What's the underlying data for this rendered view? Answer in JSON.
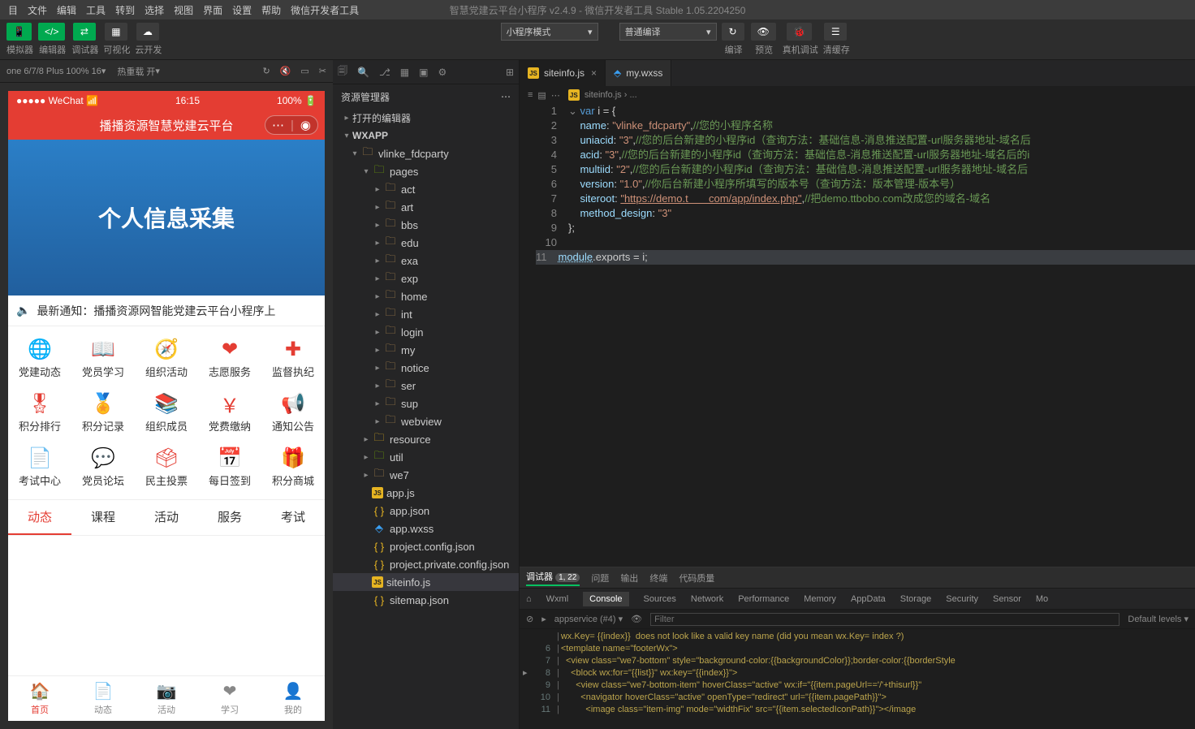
{
  "title": "智慧党建云平台小程序 v2.4.9 - 微信开发者工具 Stable 1.05.2204250",
  "menu": [
    "目",
    "文件",
    "编辑",
    "工具",
    "转到",
    "选择",
    "视图",
    "界面",
    "设置",
    "帮助",
    "微信开发者工具"
  ],
  "topButtons": [
    {
      "label": "模拟器"
    },
    {
      "label": "编辑器"
    },
    {
      "label": "调试器"
    },
    {
      "label": "可视化"
    },
    {
      "label": "云开发"
    }
  ],
  "toolbar": {
    "mode": "小程序模式",
    "compile": "普通编译",
    "compileBtn": "编译",
    "previewBtn": "预览",
    "remoteBtn": "真机调试",
    "cacheBtn": "清缓存"
  },
  "simulator": {
    "device": "one 6/7/8 Plus 100% 16",
    "hot": "热重载 开",
    "statusLeft": "●●●●● WeChat",
    "time": "16:15",
    "battery": "100%",
    "appTitle": "播播资源智慧党建云平台",
    "bannerTitle": "个人信息采集",
    "notice": "最新通知：播播资源网智能党建云平台小程序上",
    "grid": [
      "党建动态",
      "党员学习",
      "组织活动",
      "志愿服务",
      "监督执纪",
      "积分排行",
      "积分记录",
      "组织成员",
      "党费缴纳",
      "通知公告",
      "考试中心",
      "党员论坛",
      "民主投票",
      "每日签到",
      "积分商城"
    ],
    "gridIcons": [
      "🌐",
      "📖",
      "🧭",
      "❤",
      "✚",
      "🎖",
      "🏅",
      "📚",
      "￥",
      "📢",
      "📄",
      "💬",
      "🗳",
      "📅",
      "🎁"
    ],
    "tabs": [
      "动态",
      "课程",
      "活动",
      "服务",
      "考试"
    ],
    "bottom": [
      {
        "l": "首页"
      },
      {
        "l": "动态"
      },
      {
        "l": "活动"
      },
      {
        "l": "学习"
      },
      {
        "l": "我的"
      }
    ],
    "bottomIcons": [
      "🏠",
      "📄",
      "📷",
      "❤",
      "👤"
    ]
  },
  "explorer": {
    "header": "资源管理器",
    "openEditors": "打开的编辑器",
    "root": "WXAPP",
    "tree": [
      {
        "n": "vlinke_fdcparty",
        "t": "folder",
        "d": 1,
        "open": true
      },
      {
        "n": "pages",
        "t": "folder-g",
        "d": 2,
        "open": true
      },
      {
        "n": "act",
        "t": "folder",
        "d": 3
      },
      {
        "n": "art",
        "t": "folder",
        "d": 3
      },
      {
        "n": "bbs",
        "t": "folder",
        "d": 3
      },
      {
        "n": "edu",
        "t": "folder",
        "d": 3
      },
      {
        "n": "exa",
        "t": "folder",
        "d": 3
      },
      {
        "n": "exp",
        "t": "folder",
        "d": 3
      },
      {
        "n": "home",
        "t": "folder",
        "d": 3
      },
      {
        "n": "int",
        "t": "folder",
        "d": 3
      },
      {
        "n": "login",
        "t": "folder",
        "d": 3
      },
      {
        "n": "my",
        "t": "folder",
        "d": 3
      },
      {
        "n": "notice",
        "t": "folder",
        "d": 3
      },
      {
        "n": "ser",
        "t": "folder",
        "d": 3
      },
      {
        "n": "sup",
        "t": "folder",
        "d": 3
      },
      {
        "n": "webview",
        "t": "folder",
        "d": 3
      },
      {
        "n": "resource",
        "t": "folder-y",
        "d": 2
      },
      {
        "n": "util",
        "t": "folder-g",
        "d": 2
      },
      {
        "n": "we7",
        "t": "folder",
        "d": 2
      },
      {
        "n": "app.js",
        "t": "js",
        "d": 2
      },
      {
        "n": "app.json",
        "t": "json",
        "d": 2
      },
      {
        "n": "app.wxss",
        "t": "wxss",
        "d": 2
      },
      {
        "n": "project.config.json",
        "t": "json",
        "d": 2
      },
      {
        "n": "project.private.config.json",
        "t": "json",
        "d": 2
      },
      {
        "n": "siteinfo.js",
        "t": "js",
        "d": 2,
        "sel": true
      },
      {
        "n": "sitemap.json",
        "t": "json",
        "d": 2
      }
    ]
  },
  "editor": {
    "tabs": [
      {
        "n": "siteinfo.js",
        "t": "js",
        "active": true
      },
      {
        "n": "my.wxss",
        "t": "wxss"
      }
    ],
    "breadcrumb": "siteinfo.js › ...",
    "code": {
      "l1": {
        "kw": "var",
        "v": " i = {"
      },
      "l2": {
        "p": "name",
        "s": "\"vlinke_fdcparty\"",
        "c": "//您的小程序名称"
      },
      "l3": {
        "p": "uniacid",
        "s": "\"3\"",
        "c": "//您的后台新建的小程序id（查询方法：基础信息-消息推送配置-url服务器地址-域名后"
      },
      "l4": {
        "p": "acid",
        "s": "\"3\"",
        "c": "//您的后台新建的小程序id（查询方法：基础信息-消息推送配置-url服务器地址-域名后的i"
      },
      "l5": {
        "p": "multiid",
        "s": "\"2\"",
        "c": "//您的后台新建的小程序id（查询方法：基础信息-消息推送配置-url服务器地址-域名后"
      },
      "l6": {
        "p": "version",
        "s": "\"1.0\"",
        "c": "//你后台新建小程序所填写的版本号（查询方法：版本管理-版本号）"
      },
      "l7": {
        "p": "siteroot",
        "s": "\"https://demo.t       com/app/index.php\"",
        "c": "//把demo.ttbobo.com改成您的域名-域名"
      },
      "l8": {
        "p": "method_design",
        "s": "\"3\""
      },
      "l9": "};",
      "l11a": "module",
      "l11b": ".exports = i;"
    }
  },
  "devtools": {
    "tabs": [
      "调试器",
      "问题",
      "输出",
      "终端",
      "代码质量"
    ],
    "badge": "1, 22",
    "subtabs": [
      "Wxml",
      "Console",
      "Sources",
      "Network",
      "Performance",
      "Memory",
      "AppData",
      "Storage",
      "Security",
      "Sensor",
      "Mo"
    ],
    "context": "appservice (#4)",
    "filter": "Filter",
    "levels": "Default levels",
    "lines": [
      {
        "n": "",
        "t": "wx.Key= {{index}}  does not look like a valid key name (did you mean wx.Key= index ?)"
      },
      {
        "n": "6",
        "t": "<template name=\"footerWx\">"
      },
      {
        "n": "7",
        "t": "  <view class=\"we7-bottom\" style=\"background-color:{{backgroundColor}};border-color:{{borderStyle"
      },
      {
        "n": "8",
        "t": "    <block wx:for=\"{{list}}\" wx:key=\"{{index}}\">",
        "arrow": true
      },
      {
        "n": "9",
        "t": "      <view class=\"we7-bottom-item\" hoverClass=\"active\" wx:if=\"{{item.pageUrl=='/'+thisurl}}\""
      },
      {
        "n": "10",
        "t": "        <navigator hoverClass=\"active\" openType=\"redirect\" url=\"{{item.pagePath}}\">"
      },
      {
        "n": "11",
        "t": "          <image class=\"item-img\" mode=\"widthFix\" src=\"{{item.selectedIconPath}}\"></image"
      }
    ]
  }
}
